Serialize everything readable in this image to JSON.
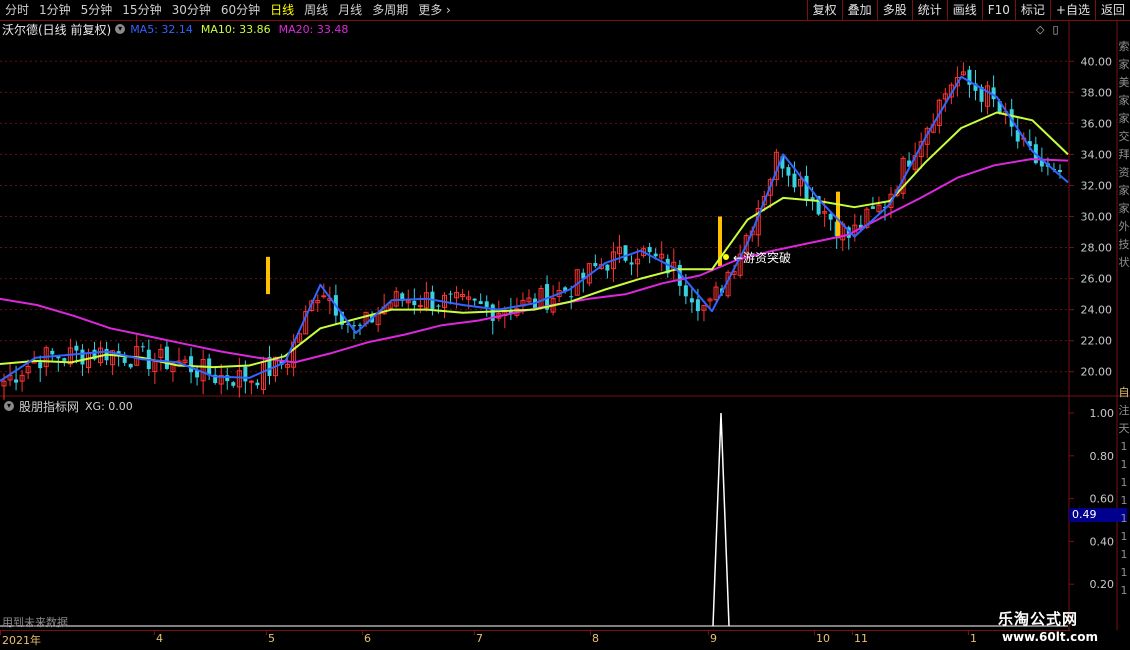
{
  "toolbar": {
    "periods": [
      "分时",
      "1分钟",
      "5分钟",
      "15分钟",
      "30分钟",
      "60分钟",
      "日线",
      "周线",
      "月线",
      "多周期",
      "更多"
    ],
    "active_period": "日线",
    "right_buttons": [
      "复权",
      "叠加",
      "多股",
      "统计",
      "画线",
      "F10",
      "标记",
      "+自选",
      "返回"
    ]
  },
  "main_chart": {
    "stock_title": "沃尔德(日线 前复权)",
    "ma5_label": "MA5: 32.14",
    "ma10_label": "MA10: 33.86",
    "ma20_label": "MA20: 33.48",
    "annotation": "←游资突破",
    "yticks": [
      "40.00",
      "38.00",
      "36.00",
      "34.00",
      "32.00",
      "30.00",
      "28.00",
      "26.00",
      "24.00",
      "22.00",
      "20.00"
    ],
    "colors": {
      "up": "#ff3333",
      "down": "#3ad0e0",
      "ma5": "#3264ff",
      "ma10": "#c8ff3c",
      "ma20": "#dc28dc",
      "signal": "#ffc000"
    }
  },
  "sub_chart": {
    "title": "股朋指标网",
    "xg_label": "XG: 0.00",
    "yticks": [
      "1.00",
      "0.80",
      "0.60",
      "0.40",
      "0.20"
    ],
    "current_value": "0.49",
    "future_note": "用到未来数据"
  },
  "xaxis": {
    "labels": [
      "2021年",
      "4",
      "5",
      "6",
      "7",
      "8",
      "9",
      "10",
      "11",
      "1"
    ]
  },
  "right_strip": {
    "top_chars": [
      "索",
      "家",
      "美",
      "家",
      "家",
      "交",
      "拜",
      "资",
      "家",
      "家",
      "外",
      "技",
      "状"
    ],
    "bottom_chars": [
      "自",
      "注",
      "天",
      "1",
      "1",
      "1",
      "1",
      "1",
      "1",
      "1",
      "1",
      "1"
    ]
  },
  "watermark": {
    "line1": "乐淘公式网",
    "line2": "www.60lt.com"
  },
  "chart_data": {
    "type": "candlestick",
    "ylim": [
      18.5,
      41.5
    ],
    "x_months": [
      "2021年",
      "4",
      "5",
      "6",
      "7",
      "8",
      "9",
      "10",
      "11",
      "1"
    ],
    "ma20": [
      24.7,
      24.3,
      23.6,
      22.8,
      22.3,
      21.8,
      21.3,
      20.9,
      20.6,
      21.2,
      21.9,
      22.4,
      23.0,
      23.3,
      23.8,
      24.3,
      24.7,
      25.0,
      25.7,
      26.2,
      27.2,
      27.8,
      28.3,
      28.8,
      30.0,
      31.2,
      32.5,
      33.3,
      33.7,
      33.6
    ],
    "ma10": [
      20.5,
      20.7,
      20.6,
      21.1,
      20.9,
      20.4,
      20.3,
      20.4,
      21.0,
      22.8,
      23.4,
      24.0,
      24.0,
      23.8,
      23.9,
      24.0,
      24.5,
      25.3,
      26.0,
      26.6,
      26.6,
      29.8,
      31.2,
      31.0,
      30.6,
      31.0,
      33.5,
      35.7,
      36.7,
      36.2,
      34.0
    ],
    "ma5": [
      19.4,
      20.9,
      21.1,
      21.3,
      20.8,
      20.6,
      19.7,
      19.6,
      20.6,
      25.6,
      22.5,
      24.6,
      24.7,
      24.3,
      24.0,
      24.4,
      25.3,
      27.0,
      27.8,
      26.6,
      23.9,
      28.3,
      34.0,
      31.1,
      28.7,
      30.8,
      35.1,
      39.0,
      37.7,
      34.2,
      32.2
    ],
    "xg_signal": [
      {
        "month": "9",
        "value": 1.0
      }
    ],
    "xg_ylim": [
      0,
      1.0
    ]
  }
}
